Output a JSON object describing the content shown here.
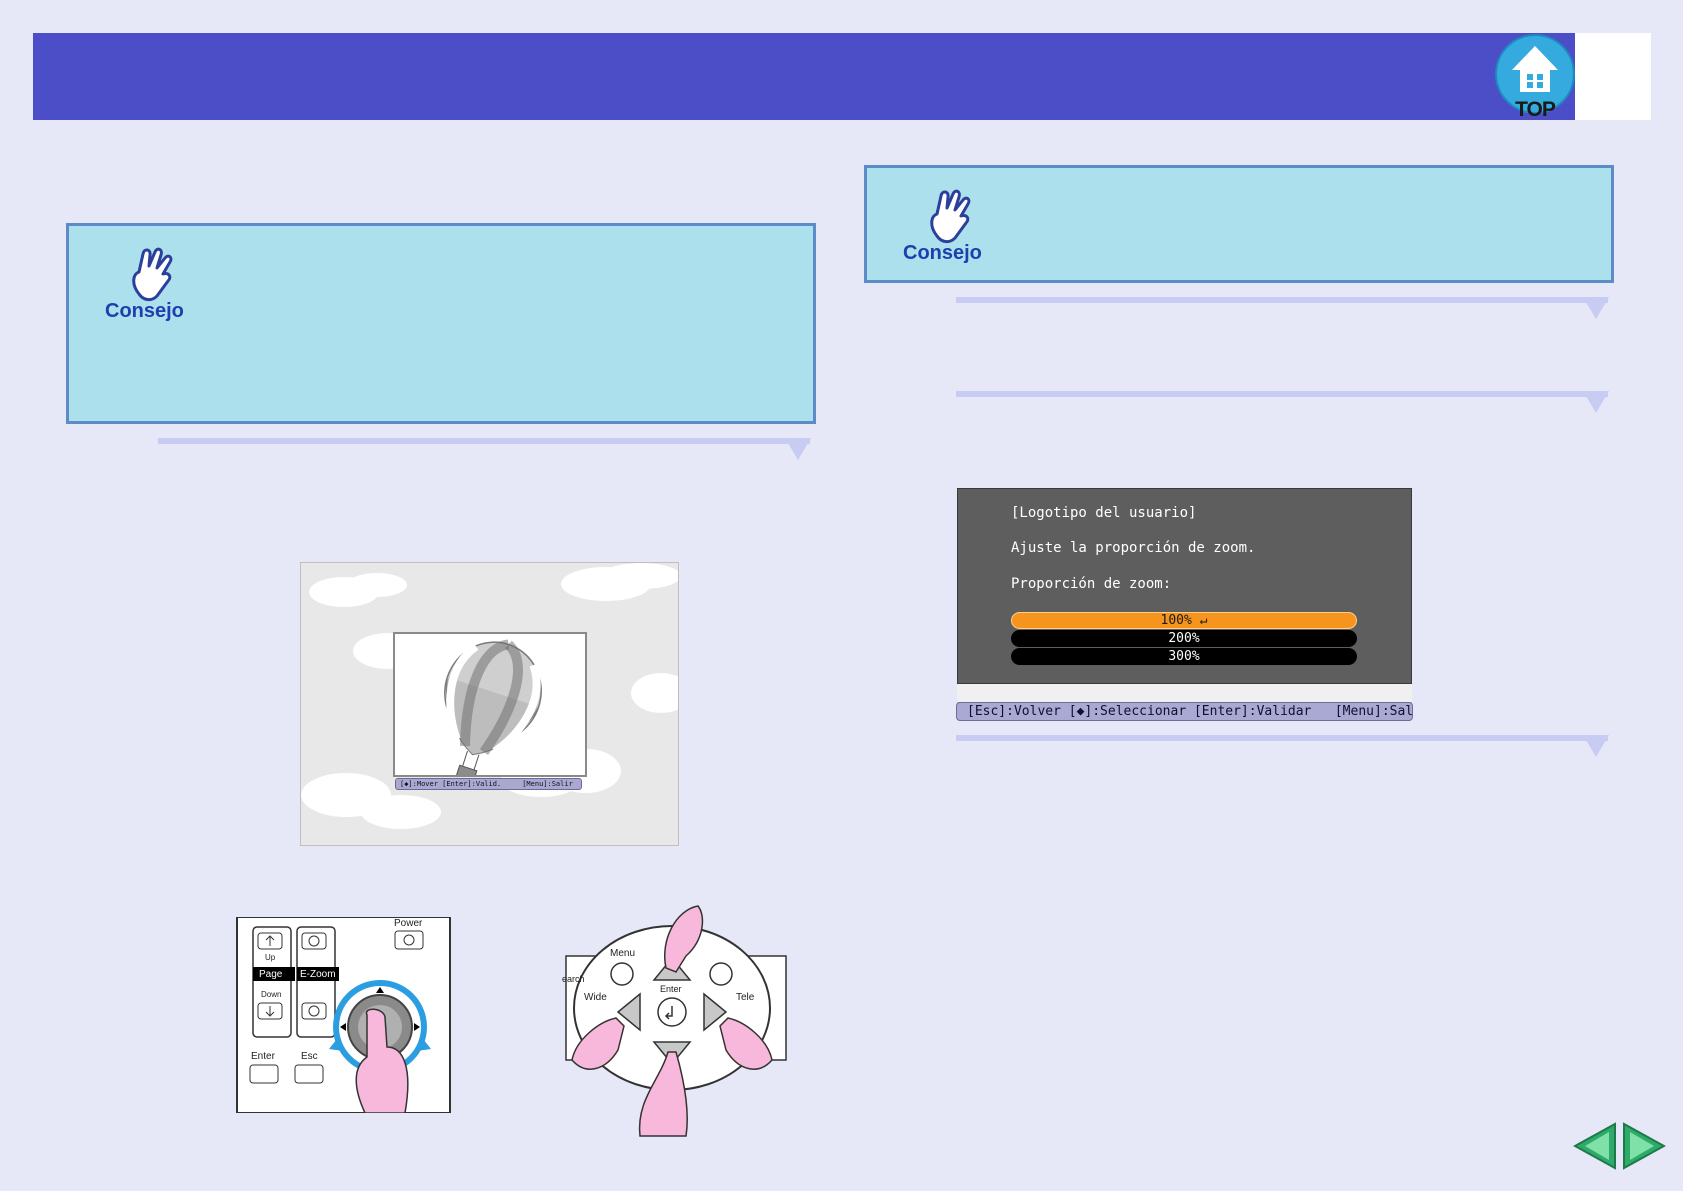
{
  "header": {
    "top_button_label": "TOP"
  },
  "tips": {
    "left_label": "Consejo",
    "right_label": "Consejo"
  },
  "projected_screen": {
    "help_bar": "[◆]:Mover [Enter]:Valid.     [Menu]:Salir"
  },
  "osd": {
    "title": "[Logotipo del usuario]",
    "instruction": "Ajuste la proporción de zoom.",
    "field_label": "Proporción de zoom:",
    "options": [
      {
        "label": "100%",
        "selected": true
      },
      {
        "label": "200%",
        "selected": false
      },
      {
        "label": "300%",
        "selected": false
      }
    ],
    "help_bar": "[Esc]:Volver [◆]:Seleccionar [Enter]:Validar   [Menu]:Salir"
  },
  "remote": {
    "buttons": {
      "page_up": "Up",
      "page": "Page",
      "page_down": "Down",
      "ezoom": "E-Zoom",
      "power": "Power",
      "enter": "Enter",
      "esc": "Esc"
    }
  },
  "control_panel": {
    "buttons": {
      "menu": "Menu",
      "enter": "Enter",
      "wide": "Wide",
      "tele": "Tele",
      "search": "earch"
    }
  },
  "nav": {
    "prev_icon": "previous-page-arrow",
    "next_icon": "next-page-arrow"
  },
  "colors": {
    "header": "#4c4ec8",
    "tip_background": "#abe0ec",
    "tip_border": "#5c8cc8",
    "osd_selected": "#f7941d",
    "page_background": "#e6e8f8"
  }
}
